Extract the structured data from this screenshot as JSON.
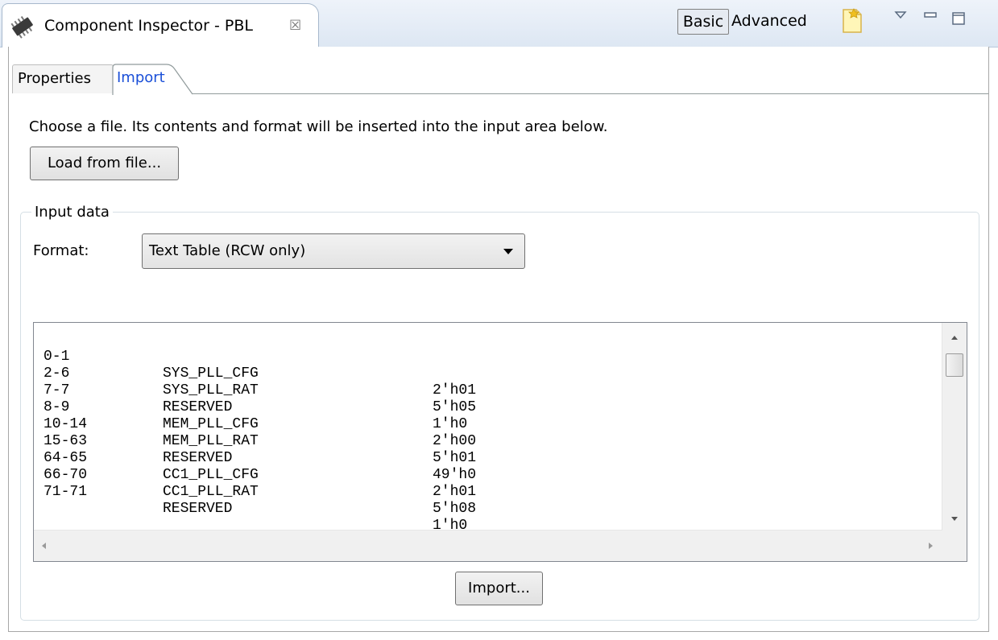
{
  "view": {
    "title": "Component Inspector - PBL",
    "close_glyph": "☒",
    "icon": "chip-icon"
  },
  "toolbar": {
    "basic_label": "Basic",
    "advanced_label": "Advanced",
    "icons": [
      "new-file-icon",
      "view-menu-icon",
      "minimize-icon",
      "maximize-icon"
    ]
  },
  "tabs": [
    {
      "label": "Properties",
      "active": false
    },
    {
      "label": "Import",
      "active": true
    }
  ],
  "import_page": {
    "intro": "Choose a file. Its contents and format will be inserted into the input area below.",
    "load_button": "Load from file...",
    "group_title": "Input data",
    "format_label": "Format:",
    "format_value": "Text Table (RCW only)",
    "rows": [
      {
        "range": "0-1",
        "name": "SYS_PLL_CFG",
        "value": "2'h01"
      },
      {
        "range": "2-6",
        "name": "SYS_PLL_RAT",
        "value": "5'h05"
      },
      {
        "range": "7-7",
        "name": "RESERVED",
        "value": "1'h0"
      },
      {
        "range": "8-9",
        "name": "MEM_PLL_CFG",
        "value": "2'h00"
      },
      {
        "range": "10-14",
        "name": "MEM_PLL_RAT",
        "value": "5'h01"
      },
      {
        "range": "15-63",
        "name": "RESERVED",
        "value": "49'h0"
      },
      {
        "range": "64-65",
        "name": "CC1_PLL_CFG",
        "value": "2'h01"
      },
      {
        "range": "66-70",
        "name": "CC1_PLL_RAT",
        "value": "5'h08"
      },
      {
        "range": "71-71",
        "name": "RESERVED",
        "value": "1'h0"
      }
    ],
    "import_button": "Import..."
  },
  "colors": {
    "active_tab_text": "#1a4fd8",
    "titlebar_bg": "#dde7f3"
  }
}
